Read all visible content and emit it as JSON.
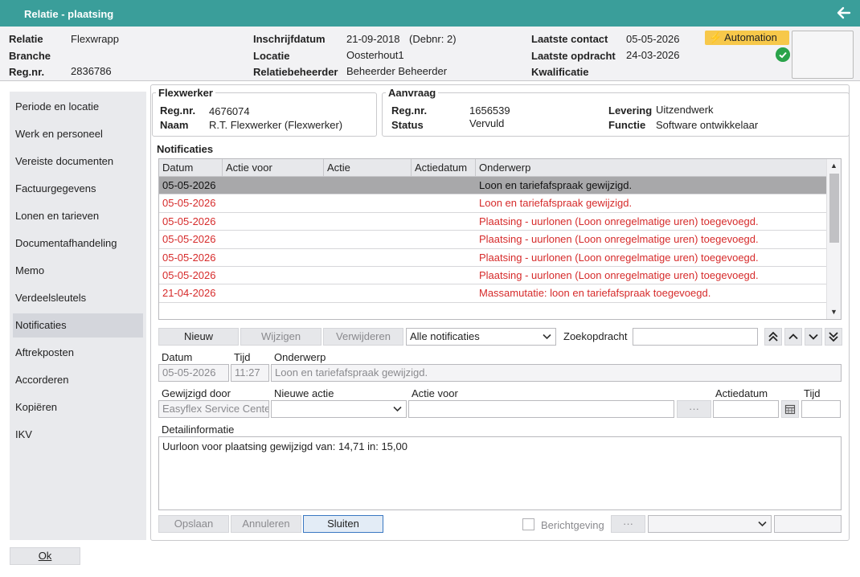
{
  "window": {
    "title": "Relatie - plaatsing"
  },
  "header": {
    "relatie_label": "Relatie",
    "relatie_value": "Flexwrapp",
    "branche_label": "Branche",
    "regnr_label": "Reg.nr.",
    "regnr_value": "2836786",
    "inschrijfdatum_label": "Inschrijfdatum",
    "inschrijfdatum_value": "21-09-2018",
    "debnr": "(Debnr: 2)",
    "locatie_label": "Locatie",
    "locatie_value": "Oosterhout1",
    "relatiebeheerder_label": "Relatiebeheerder",
    "relatiebeheerder_value": "Beheerder Beheerder",
    "laatste_contact_label": "Laatste contact",
    "laatste_contact_value": "05-05-2026",
    "laatste_opdracht_label": "Laatste opdracht",
    "laatste_opdracht_value": "24-03-2026",
    "kwalificatie_label": "Kwalificatie",
    "automation_badge": "Automation",
    "automation_color": "#f7c84a",
    "status_icon": "check-circle-icon"
  },
  "sidebar": {
    "items": [
      {
        "label": "Periode en locatie"
      },
      {
        "label": "Werk en personeel"
      },
      {
        "label": "Vereiste documenten"
      },
      {
        "label": "Factuurgegevens"
      },
      {
        "label": "Lonen en tarieven"
      },
      {
        "label": "Documentafhandeling"
      },
      {
        "label": "Memo"
      },
      {
        "label": "Verdeelsleutels"
      },
      {
        "label": "Notificaties"
      },
      {
        "label": "Aftrekposten"
      },
      {
        "label": "Accorderen"
      },
      {
        "label": "Kopiëren"
      },
      {
        "label": "IKV"
      }
    ],
    "active_index": 8
  },
  "ok_button": "Ok",
  "flexwerker": {
    "legend": "Flexwerker",
    "regnr_label": "Reg.nr.",
    "regnr_value": "4676074",
    "naam_label": "Naam",
    "naam_value": "R.T. Flexwerker (Flexwerker)"
  },
  "aanvraag": {
    "legend": "Aanvraag",
    "regnr_label": "Reg.nr.",
    "regnr_value": "1656539",
    "status_label": "Status",
    "status_value": "Vervuld",
    "levering_label": "Levering",
    "levering_value": "Uitzendwerk",
    "functie_label": "Functie",
    "functie_value": "Software ontwikkelaar"
  },
  "notificaties": {
    "legend": "Notificaties",
    "columns": [
      "Datum",
      "Actie voor",
      "Actie",
      "Actiedatum",
      "Onderwerp"
    ],
    "rows": [
      {
        "datum": "05-05-2026",
        "onderwerp": "Loon en tariefafspraak gewijzigd."
      },
      {
        "datum": "05-05-2026",
        "onderwerp": "Loon en tariefafspraak gewijzigd."
      },
      {
        "datum": "05-05-2026",
        "onderwerp": "Plaatsing - uurlonen (Loon onregelmatige uren) toegevoegd."
      },
      {
        "datum": "05-05-2026",
        "onderwerp": "Plaatsing - uurlonen (Loon onregelmatige uren) toegevoegd."
      },
      {
        "datum": "05-05-2026",
        "onderwerp": "Plaatsing - uurlonen (Loon onregelmatige uren) toegevoegd."
      },
      {
        "datum": "05-05-2026",
        "onderwerp": "Plaatsing - uurlonen (Loon onregelmatige uren) toegevoegd."
      },
      {
        "datum": "21-04-2026",
        "onderwerp": "Massamutatie: loon en tariefafspraak toegevoegd."
      }
    ],
    "selected_index": 0,
    "row_text_color": "#d62b2b"
  },
  "toolbar": {
    "nieuw": "Nieuw",
    "wijzigen": "Wijzigen",
    "verwijderen": "Verwijderen",
    "filter_value": "Alle notificaties",
    "zoekopdracht_label": "Zoekopdracht",
    "zoekopdracht_value": ""
  },
  "form": {
    "datum_label": "Datum",
    "datum_value": "05-05-2026",
    "tijd_label": "Tijd",
    "tijd_value": "11:27",
    "onderwerp_label": "Onderwerp",
    "onderwerp_value": "Loon en tariefafspraak gewijzigd.",
    "gewijzigd_door_label": "Gewijzigd door",
    "gewijzigd_door_value": "Easyflex Service Center",
    "nieuwe_actie_label": "Nieuwe actie",
    "nieuwe_actie_value": "",
    "actie_voor_label": "Actie voor",
    "actie_voor_value": "",
    "ellipsis": "···",
    "actiedatum_label": "Actiedatum",
    "actiedatum_value": "",
    "tijd2_label": "Tijd",
    "tijd2_value": "",
    "detail_label": "Detailinformatie",
    "detail_value": "Uurloon voor plaatsing gewijzigd van: 14,71 in: 15,00"
  },
  "footer": {
    "opslaan": "Opslaan",
    "annuleren": "Annuleren",
    "sluiten": "Sluiten",
    "berichtgeving_label": "Berichtgeving",
    "ellipsis": "···",
    "select_value": "",
    "field_value": ""
  }
}
